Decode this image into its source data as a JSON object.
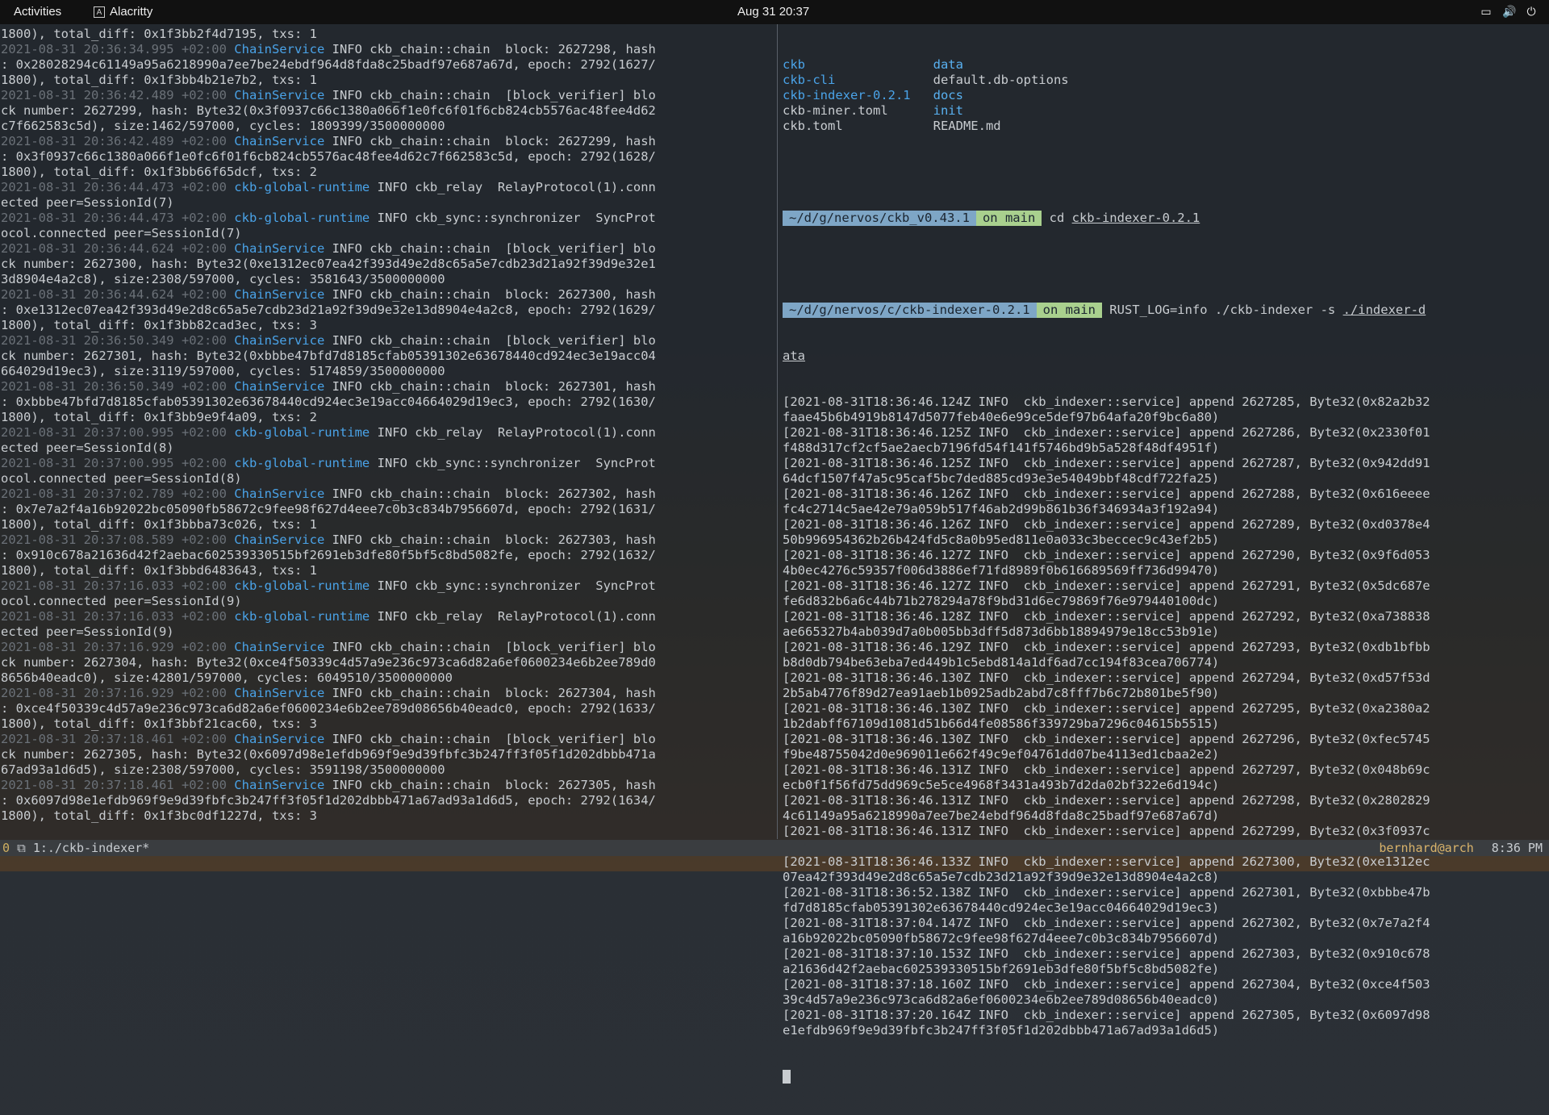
{
  "topbar": {
    "activities": "Activities",
    "app_name": "Alacritty",
    "app_icon_glyph": "A",
    "clock": "Aug 31  20:37",
    "tray_icons": [
      "screen-icon",
      "volume-icon",
      "power-icon"
    ]
  },
  "left_pane": {
    "lines": [
      [
        [
          "",
          "1800), total_diff: 0x1f3bb2f4d7195, txs: 1"
        ]
      ],
      [
        [
          "ts",
          "2021-08-31 20:36:34.995 +02:00 "
        ],
        [
          "cs",
          "ChainService"
        ],
        [
          "",
          " INFO ckb_chain::chain  block: 2627298, hash"
        ]
      ],
      [
        [
          "",
          ": 0x28028294c61149a95a6218990a7ee7be24ebdf964d8fda8c25badf97e687a67d, epoch: 2792(1627/"
        ]
      ],
      [
        [
          "",
          "1800), total_diff: 0x1f3bb4b21e7b2, txs: 1"
        ]
      ],
      [
        [
          "ts",
          "2021-08-31 20:36:42.489 +02:00 "
        ],
        [
          "cs",
          "ChainService"
        ],
        [
          "",
          " INFO ckb_chain::chain  [block_verifier] blo"
        ]
      ],
      [
        [
          "",
          "ck number: 2627299, hash: Byte32(0x3f0937c66c1380a066f1e0fc6f01f6cb824cb5576ac48fee4d62"
        ]
      ],
      [
        [
          "",
          "c7f662583c5d), size:1462/597000, cycles: 1809399/3500000000"
        ]
      ],
      [
        [
          "ts",
          "2021-08-31 20:36:42.489 +02:00 "
        ],
        [
          "cs",
          "ChainService"
        ],
        [
          "",
          " INFO ckb_chain::chain  block: 2627299, hash"
        ]
      ],
      [
        [
          "",
          ": 0x3f0937c66c1380a066f1e0fc6f01f6cb824cb5576ac48fee4d62c7f662583c5d, epoch: 2792(1628/"
        ]
      ],
      [
        [
          "",
          "1800), total_diff: 0x1f3bb66f65dcf, txs: 2"
        ]
      ],
      [
        [
          "ts",
          "2021-08-31 20:36:44.473 +02:00 "
        ],
        [
          "gr",
          "ckb-global-runtime"
        ],
        [
          "",
          " INFO ckb_relay  RelayProtocol(1).conn"
        ]
      ],
      [
        [
          "",
          "ected peer=SessionId(7)"
        ]
      ],
      [
        [
          "ts",
          "2021-08-31 20:36:44.473 +02:00 "
        ],
        [
          "gr",
          "ckb-global-runtime"
        ],
        [
          "",
          " INFO ckb_sync::synchronizer  SyncProt"
        ]
      ],
      [
        [
          "",
          "ocol.connected peer=SessionId(7)"
        ]
      ],
      [
        [
          "ts",
          "2021-08-31 20:36:44.624 +02:00 "
        ],
        [
          "cs",
          "ChainService"
        ],
        [
          "",
          " INFO ckb_chain::chain  [block_verifier] blo"
        ]
      ],
      [
        [
          "",
          "ck number: 2627300, hash: Byte32(0xe1312ec07ea42f393d49e2d8c65a5e7cdb23d21a92f39d9e32e1"
        ]
      ],
      [
        [
          "",
          "3d8904e4a2c8), size:2308/597000, cycles: 3581643/3500000000"
        ]
      ],
      [
        [
          "ts",
          "2021-08-31 20:36:44.624 +02:00 "
        ],
        [
          "cs",
          "ChainService"
        ],
        [
          "",
          " INFO ckb_chain::chain  block: 2627300, hash"
        ]
      ],
      [
        [
          "",
          ": 0xe1312ec07ea42f393d49e2d8c65a5e7cdb23d21a92f39d9e32e13d8904e4a2c8, epoch: 2792(1629/"
        ]
      ],
      [
        [
          "",
          "1800), total_diff: 0x1f3bb82cad3ec, txs: 3"
        ]
      ],
      [
        [
          "ts",
          "2021-08-31 20:36:50.349 +02:00 "
        ],
        [
          "cs",
          "ChainService"
        ],
        [
          "",
          " INFO ckb_chain::chain  [block_verifier] blo"
        ]
      ],
      [
        [
          "",
          "ck number: 2627301, hash: Byte32(0xbbbe47bfd7d8185cfab05391302e63678440cd924ec3e19acc04"
        ]
      ],
      [
        [
          "",
          "664029d19ec3), size:3119/597000, cycles: 5174859/3500000000"
        ]
      ],
      [
        [
          "ts",
          "2021-08-31 20:36:50.349 +02:00 "
        ],
        [
          "cs",
          "ChainService"
        ],
        [
          "",
          " INFO ckb_chain::chain  block: 2627301, hash"
        ]
      ],
      [
        [
          "",
          ": 0xbbbe47bfd7d8185cfab05391302e63678440cd924ec3e19acc04664029d19ec3, epoch: 2792(1630/"
        ]
      ],
      [
        [
          "",
          "1800), total_diff: 0x1f3bb9e9f4a09, txs: 2"
        ]
      ],
      [
        [
          "ts",
          "2021-08-31 20:37:00.995 +02:00 "
        ],
        [
          "gr",
          "ckb-global-runtime"
        ],
        [
          "",
          " INFO ckb_relay  RelayProtocol(1).conn"
        ]
      ],
      [
        [
          "",
          "ected peer=SessionId(8)"
        ]
      ],
      [
        [
          "ts",
          "2021-08-31 20:37:00.995 +02:00 "
        ],
        [
          "gr",
          "ckb-global-runtime"
        ],
        [
          "",
          " INFO ckb_sync::synchronizer  SyncProt"
        ]
      ],
      [
        [
          "",
          "ocol.connected peer=SessionId(8)"
        ]
      ],
      [
        [
          "ts",
          "2021-08-31 20:37:02.789 +02:00 "
        ],
        [
          "cs",
          "ChainService"
        ],
        [
          "",
          " INFO ckb_chain::chain  block: 2627302, hash"
        ]
      ],
      [
        [
          "",
          ": 0x7e7a2f4a16b92022bc05090fb58672c9fee98f627d4eee7c0b3c834b7956607d, epoch: 2792(1631/"
        ]
      ],
      [
        [
          "",
          "1800), total_diff: 0x1f3bbba73c026, txs: 1"
        ]
      ],
      [
        [
          "ts",
          "2021-08-31 20:37:08.589 +02:00 "
        ],
        [
          "cs",
          "ChainService"
        ],
        [
          "",
          " INFO ckb_chain::chain  block: 2627303, hash"
        ]
      ],
      [
        [
          "",
          ": 0x910c678a21636d42f2aebac602539330515bf2691eb3dfe80f5bf5c8bd5082fe, epoch: 2792(1632/"
        ]
      ],
      [
        [
          "",
          "1800), total_diff: 0x1f3bbd6483643, txs: 1"
        ]
      ],
      [
        [
          "ts",
          "2021-08-31 20:37:16.033 +02:00 "
        ],
        [
          "gr",
          "ckb-global-runtime"
        ],
        [
          "",
          " INFO ckb_sync::synchronizer  SyncProt"
        ]
      ],
      [
        [
          "",
          "ocol.connected peer=SessionId(9)"
        ]
      ],
      [
        [
          "ts",
          "2021-08-31 20:37:16.033 +02:00 "
        ],
        [
          "gr",
          "ckb-global-runtime"
        ],
        [
          "",
          " INFO ckb_relay  RelayProtocol(1).conn"
        ]
      ],
      [
        [
          "",
          "ected peer=SessionId(9)"
        ]
      ],
      [
        [
          "ts",
          "2021-08-31 20:37:16.929 +02:00 "
        ],
        [
          "cs",
          "ChainService"
        ],
        [
          "",
          " INFO ckb_chain::chain  [block_verifier] blo"
        ]
      ],
      [
        [
          "",
          "ck number: 2627304, hash: Byte32(0xce4f50339c4d57a9e236c973ca6d82a6ef0600234e6b2ee789d0"
        ]
      ],
      [
        [
          "",
          "8656b40eadc0), size:42801/597000, cycles: 6049510/3500000000"
        ]
      ],
      [
        [
          "ts",
          "2021-08-31 20:37:16.929 +02:00 "
        ],
        [
          "cs",
          "ChainService"
        ],
        [
          "",
          " INFO ckb_chain::chain  block: 2627304, hash"
        ]
      ],
      [
        [
          "",
          ": 0xce4f50339c4d57a9e236c973ca6d82a6ef0600234e6b2ee789d08656b40eadc0, epoch: 2792(1633/"
        ]
      ],
      [
        [
          "",
          "1800), total_diff: 0x1f3bbf21cac60, txs: 3"
        ]
      ],
      [
        [
          "ts",
          "2021-08-31 20:37:18.461 +02:00 "
        ],
        [
          "cs",
          "ChainService"
        ],
        [
          "",
          " INFO ckb_chain::chain  [block_verifier] blo"
        ]
      ],
      [
        [
          "",
          "ck number: 2627305, hash: Byte32(0x6097d98e1efdb969f9e9d39fbfc3b247ff3f05f1d202dbbb471a"
        ]
      ],
      [
        [
          "",
          "67ad93a1d6d5), size:2308/597000, cycles: 3591198/3500000000"
        ]
      ],
      [
        [
          "ts",
          "2021-08-31 20:37:18.461 +02:00 "
        ],
        [
          "cs",
          "ChainService"
        ],
        [
          "",
          " INFO ckb_chain::chain  block: 2627305, hash"
        ]
      ],
      [
        [
          "",
          ": 0x6097d98e1efdb969f9e9d39fbfc3b247ff3f05f1d202dbbb471a67ad93a1d6d5, epoch: 2792(1634/"
        ]
      ],
      [
        [
          "",
          "1800), total_diff: 0x1f3bc0df1227d, txs: 3"
        ]
      ]
    ]
  },
  "right_pane": {
    "ls_rows": [
      [
        [
          "dirc",
          "ckb                 "
        ],
        [
          "dir",
          "data"
        ]
      ],
      [
        [
          "dirc",
          "ckb-cli             "
        ],
        [
          "",
          "default.db-options"
        ]
      ],
      [
        [
          "dirc",
          "ckb-indexer-0.2.1   "
        ],
        [
          "dir",
          "docs"
        ]
      ],
      [
        [
          "",
          "ckb-miner.toml      "
        ],
        [
          "dir",
          "init"
        ]
      ],
      [
        [
          "",
          "ckb.toml            "
        ],
        [
          "",
          "README.md"
        ]
      ]
    ],
    "prompt1": {
      "path": "~/d/g/nervos/ckb_v0.43.1",
      "branch": "on main",
      "cmd_pre": " cd ",
      "cmd_arg": "ckb-indexer-0.2.1"
    },
    "prompt2": {
      "path": "~/d/g/nervos/c/ckb-indexer-0.2.1",
      "branch": "on main",
      "cmd_pre": " RUST_LOG=info ./ckb-indexer -s ",
      "cmd_arg": "./indexer-d",
      "cmd_wrap": "ata"
    },
    "log_lines": [
      [
        "[2021-08-31T18:36:46.124Z INFO  ckb_indexer::service] append 2627285, Byte32(0x82a2b32",
        "faae45b6b4919b8147d5077feb40e6e99ce5def97b64afa20f9bc6a80)"
      ],
      [
        "[2021-08-31T18:36:46.125Z INFO  ckb_indexer::service] append 2627286, Byte32(0x2330f01",
        "f488d317cf2cf5ae2aecb7196fd54f141f5746bd9b5a528f48df4951f)"
      ],
      [
        "[2021-08-31T18:36:46.125Z INFO  ckb_indexer::service] append 2627287, Byte32(0x942dd91",
        "64dcf1507f47a5c95caf5bc7ded885cd93e3e54049bbf48cdf722fa25)"
      ],
      [
        "[2021-08-31T18:36:46.126Z INFO  ckb_indexer::service] append 2627288, Byte32(0x616eeee",
        "fc4c2714c5ae42e79a059b517f46ab2d99b861b36f346934a3f192a94)"
      ],
      [
        "[2021-08-31T18:36:46.126Z INFO  ckb_indexer::service] append 2627289, Byte32(0xd0378e4",
        "50b996954362b26b424fd5c8a0b95ed811e0a033c3beccec9c43ef2b5)"
      ],
      [
        "[2021-08-31T18:36:46.127Z INFO  ckb_indexer::service] append 2627290, Byte32(0x9f6d053",
        "4b0ec4276c59357f006d3886ef71fd8989f0b616689569ff736d99470)"
      ],
      [
        "[2021-08-31T18:36:46.127Z INFO  ckb_indexer::service] append 2627291, Byte32(0x5dc687e",
        "fe6d832b6a6c44b71b278294a78f9bd31d6ec79869f76e979440100dc)"
      ],
      [
        "[2021-08-31T18:36:46.128Z INFO  ckb_indexer::service] append 2627292, Byte32(0xa738838",
        "ae665327b4ab039d7a0b005bb3dff5d873d6bb18894979e18cc53b91e)"
      ],
      [
        "[2021-08-31T18:36:46.129Z INFO  ckb_indexer::service] append 2627293, Byte32(0xdb1bfbb",
        "b8d0db794be63eba7ed449b1c5ebd814a1df6ad7cc194f83cea706774)"
      ],
      [
        "[2021-08-31T18:36:46.130Z INFO  ckb_indexer::service] append 2627294, Byte32(0xd57f53d",
        "2b5ab4776f89d27ea91aeb1b0925adb2abd7c8fff7b6c72b801be5f90)"
      ],
      [
        "[2021-08-31T18:36:46.130Z INFO  ckb_indexer::service] append 2627295, Byte32(0xa2380a2",
        "1b2dabff67109d1081d51b66d4fe08586f339729ba7296c04615b5515)"
      ],
      [
        "[2021-08-31T18:36:46.130Z INFO  ckb_indexer::service] append 2627296, Byte32(0xfec5745",
        "f9be48755042d0e969011e662f49c9ef04761dd07be4113ed1cbaa2e2)"
      ],
      [
        "[2021-08-31T18:36:46.131Z INFO  ckb_indexer::service] append 2627297, Byte32(0x048b69c",
        "ecb0f1f56fd75dd969c5e5ce4968f3431a493b7d2da02bf322e6d194c)"
      ],
      [
        "[2021-08-31T18:36:46.131Z INFO  ckb_indexer::service] append 2627298, Byte32(0x2802829",
        "4c61149a95a6218990a7ee7be24ebdf964d8fda8c25badf97e687a67d)"
      ],
      [
        "[2021-08-31T18:36:46.131Z INFO  ckb_indexer::service] append 2627299, Byte32(0x3f0937c",
        "66c1380a066f1e0fc6f01f6cb824cb5576ac48fee4d62c7f662583c5d)"
      ],
      [
        "[2021-08-31T18:36:46.133Z INFO  ckb_indexer::service] append 2627300, Byte32(0xe1312ec",
        "07ea42f393d49e2d8c65a5e7cdb23d21a92f39d9e32e13d8904e4a2c8)"
      ],
      [
        "[2021-08-31T18:36:52.138Z INFO  ckb_indexer::service] append 2627301, Byte32(0xbbbe47b",
        "fd7d8185cfab05391302e63678440cd924ec3e19acc04664029d19ec3)"
      ],
      [
        "[2021-08-31T18:37:04.147Z INFO  ckb_indexer::service] append 2627302, Byte32(0x7e7a2f4",
        "a16b92022bc05090fb58672c9fee98f627d4eee7c0b3c834b7956607d)"
      ],
      [
        "[2021-08-31T18:37:10.153Z INFO  ckb_indexer::service] append 2627303, Byte32(0x910c678",
        "a21636d42f2aebac602539330515bf2691eb3dfe80f5bf5c8bd5082fe)"
      ],
      [
        "[2021-08-31T18:37:18.160Z INFO  ckb_indexer::service] append 2627304, Byte32(0xce4f503",
        "39c4d57a9e236c973ca6d82a6ef0600234e6b2ee789d08656b40eadc0)"
      ],
      [
        "[2021-08-31T18:37:20.164Z INFO  ckb_indexer::service] append 2627305, Byte32(0x6097d98",
        "e1efdb969f9e9d39fbfc3b247ff3f05f1d202dbbb471a67ad93a1d6d5)"
      ]
    ]
  },
  "status_bar": {
    "session": "0",
    "window": "1:./ckb-indexer*",
    "host": "bernhard@arch",
    "time": "8:36 PM"
  }
}
